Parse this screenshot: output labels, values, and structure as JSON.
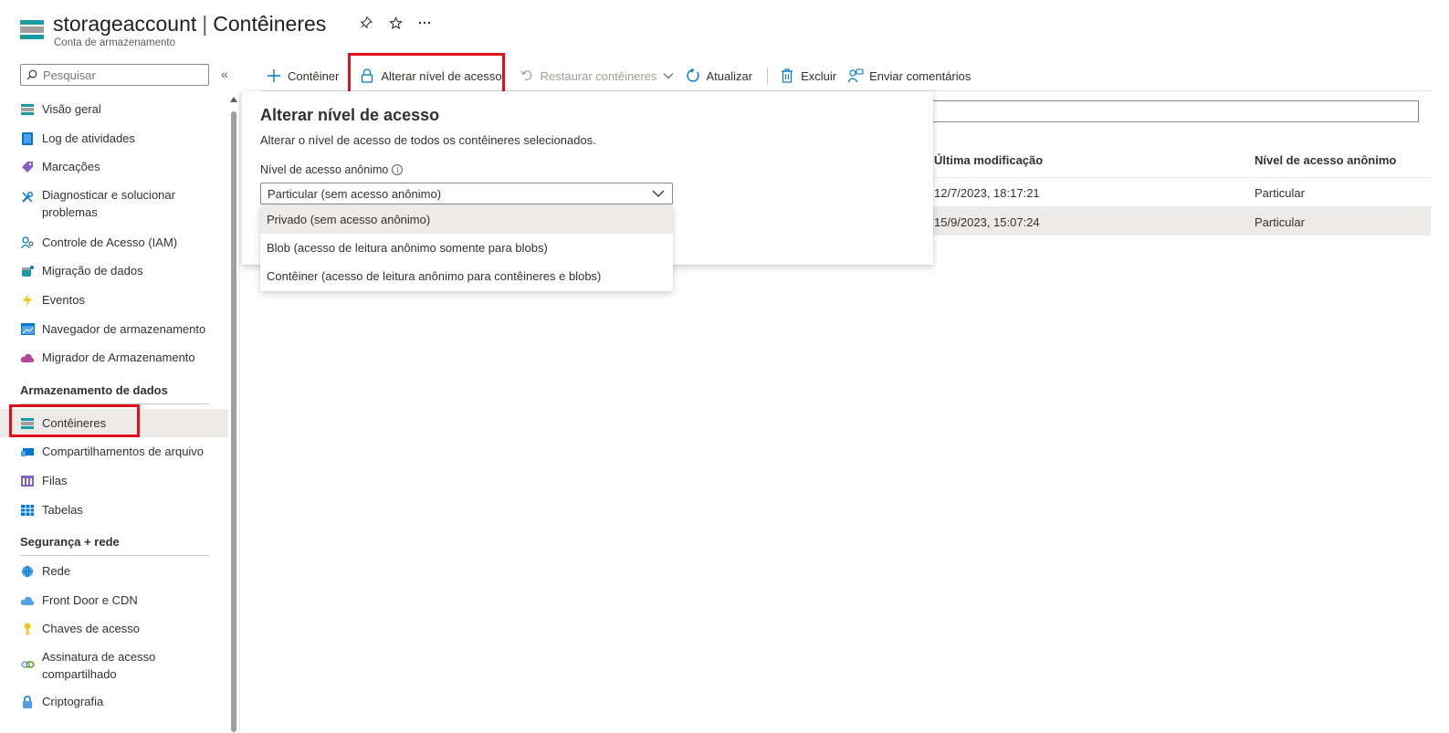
{
  "header": {
    "title": "storageaccount",
    "title_separator": "|",
    "page": "Contêineres",
    "subtitle": "Conta de armazenamento",
    "actions": [
      "pin-icon",
      "star-icon",
      "more-icon"
    ]
  },
  "sidebar": {
    "search_placeholder": "Pesquisar",
    "items_top": [
      {
        "label": "Visão geral",
        "icon": "overview-icon"
      },
      {
        "label": "Log de atividades",
        "icon": "activity-log-icon"
      },
      {
        "label": "Marcações",
        "icon": "tag-icon"
      },
      {
        "label": "Diagnosticar e solucionar problemas",
        "icon": "wrench-icon"
      },
      {
        "label": "Controle de Acesso (IAM)",
        "icon": "iam-icon"
      },
      {
        "label": "Migração de dados",
        "icon": "data-migration-icon"
      },
      {
        "label": "Eventos",
        "icon": "lightning-icon"
      },
      {
        "label": "Navegador de armazenamento",
        "icon": "storage-browser-icon"
      },
      {
        "label": "Migrador de Armazenamento",
        "icon": "cloud-icon"
      }
    ],
    "section_data": "Armazenamento de dados",
    "items_data": [
      {
        "label": "Contêineres",
        "icon": "containers-icon",
        "selected": true
      },
      {
        "label": "Compartilhamentos de arquivo",
        "icon": "file-share-icon"
      },
      {
        "label": "Filas",
        "icon": "queue-icon"
      },
      {
        "label": "Tabelas",
        "icon": "table-icon"
      }
    ],
    "section_security": "Segurança + rede",
    "items_security": [
      {
        "label": "Rede",
        "icon": "network-icon"
      },
      {
        "label": "Front Door e CDN",
        "icon": "cdn-icon"
      },
      {
        "label": "Chaves de acesso",
        "icon": "key-icon"
      },
      {
        "label": "Assinatura de acesso compartilhado",
        "icon": "link-icon"
      },
      {
        "label": "Criptografia",
        "icon": "lock-icon"
      }
    ]
  },
  "toolbar": {
    "add_container": "Contêiner",
    "change_access": "Alterar nível de acesso",
    "restore": "Restaurar contêineres",
    "refresh": "Atualizar",
    "delete": "Excluir",
    "feedback": "Enviar comentários"
  },
  "table": {
    "col_modified": "Última modificação",
    "col_access": "Nível de acesso anônimo",
    "rows": [
      {
        "modified": "12/7/2023, 18:17:21",
        "access": "Particular"
      },
      {
        "modified": "15/9/2023, 15:07:24",
        "access": "Particular"
      }
    ]
  },
  "panel": {
    "title": "Alterar nível de acesso",
    "description": "Alterar o nível de acesso de todos os contêineres selecionados.",
    "field_label": "Nível de acesso anônimo",
    "selected_value": "Particular (sem acesso anônimo)",
    "options": [
      "Privado (sem acesso anônimo)",
      "Blob (acesso de leitura anônimo somente para blobs)",
      "Contêiner (acesso de leitura anônimo para contêineres e blobs)"
    ]
  },
  "colors": {
    "accent": "#0078d4",
    "highlight_box": "#e3101b",
    "selected_bg": "#edebe9"
  }
}
